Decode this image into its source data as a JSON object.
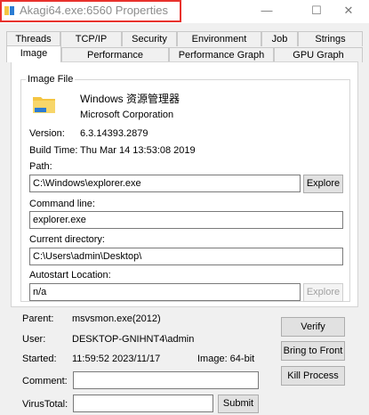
{
  "window": {
    "title": "Akagi64.exe:6560 Properties",
    "minimize_glyph": "—",
    "maximize_glyph": "☐",
    "close_glyph": "✕"
  },
  "tabs_row1": [
    "Threads",
    "TCP/IP",
    "Security",
    "Environment",
    "Job",
    "Strings"
  ],
  "tabs_row2": [
    "Image",
    "Performance",
    "Performance Graph",
    "GPU Graph"
  ],
  "image_file": {
    "group_label": "Image File",
    "description": "Windows 资源管理器",
    "company": "Microsoft Corporation",
    "version_label": "Version:",
    "version": "6.3.14393.2879",
    "build_label": "Build Time:",
    "build_time": "Thu Mar 14 13:53:08 2019",
    "path_label": "Path:",
    "path": "C:\\Windows\\explorer.exe",
    "explore_label": "Explore",
    "cmdline_label": "Command line:",
    "cmdline": "explorer.exe",
    "curdir_label": "Current directory:",
    "curdir": "C:\\Users\\admin\\Desktop\\",
    "autostart_label": "Autostart Location:",
    "autostart": "n/a",
    "explore2_label": "Explore"
  },
  "process": {
    "parent_label": "Parent:",
    "parent": "msvsmon.exe(2012)",
    "user_label": "User:",
    "user": "DESKTOP-GNIHNT4\\admin",
    "started_label": "Started:",
    "started": "11:59:52  2023/11/17",
    "image_bits": "Image: 64-bit",
    "comment_label": "Comment:",
    "comment": "",
    "virustotal_label": "VirusTotal:",
    "virustotal": "",
    "submit_label": "Submit"
  },
  "side_buttons": {
    "verify": "Verify",
    "bring_to_front": "Bring to Front",
    "kill_process": "Kill Process"
  },
  "colors": {
    "highlight_border": "#e8322d",
    "folder_yellow": "#f4c542",
    "folder_blue": "#2b7cd3"
  }
}
